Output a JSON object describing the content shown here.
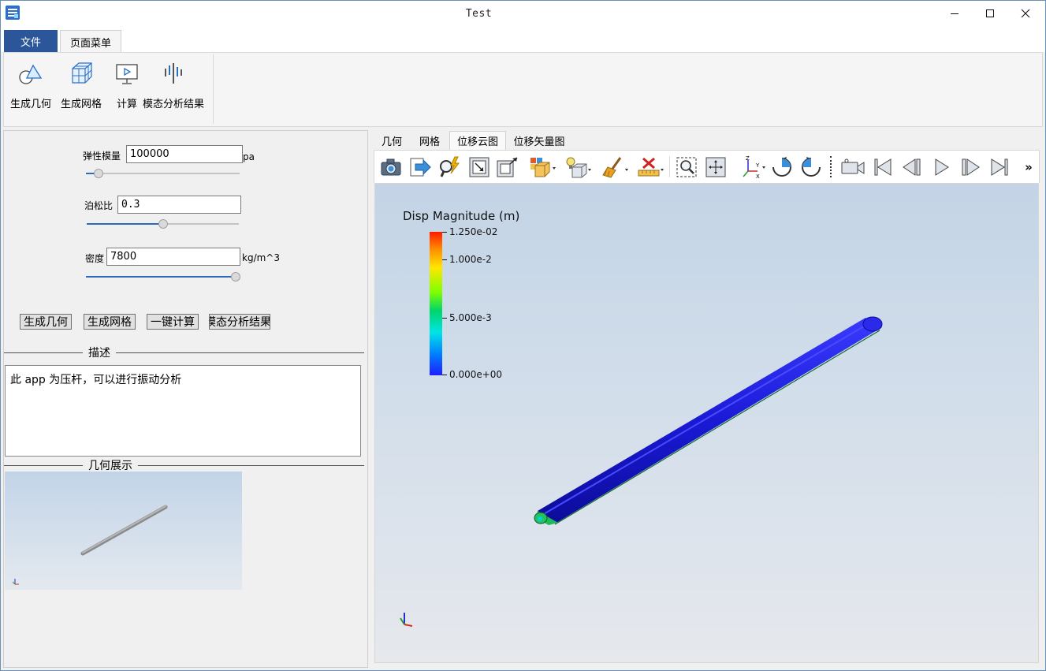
{
  "window": {
    "title": "Test",
    "icons": [
      "app-icon",
      "minimize-icon",
      "maximize-icon",
      "close-icon"
    ]
  },
  "ribbon": {
    "tabs": [
      {
        "label": "文件",
        "active": false
      },
      {
        "label": "页面菜单",
        "active": true
      }
    ],
    "buttons": [
      {
        "label": "生成几何",
        "icon": "geometry-icon"
      },
      {
        "label": "生成网格",
        "icon": "mesh-icon"
      },
      {
        "label": "计算",
        "icon": "compute-icon"
      },
      {
        "label": "模态分析结果",
        "icon": "modal-analysis-icon"
      }
    ]
  },
  "params": {
    "elastic_modulus": {
      "label": "弹性模量",
      "value": "100000",
      "unit": "pa",
      "slider_fraction": 0.08
    },
    "poisson_ratio": {
      "label": "泊松比",
      "value": "0.3",
      "unit": "",
      "slider_fraction": 0.5
    },
    "density": {
      "label": "密度",
      "value": "7800",
      "unit": "kg/m^3",
      "slider_fraction": 1.0
    }
  },
  "actions": [
    "生成几何",
    "生成网格",
    "一键计算",
    "模态分析结果"
  ],
  "description": {
    "title": "描述",
    "text": "此 app 为压杆，可以进行振动分析"
  },
  "geometry_preview": {
    "title": "几何展示"
  },
  "view_tabs": [
    {
      "label": "几何",
      "active": false
    },
    {
      "label": "网格",
      "active": false
    },
    {
      "label": "位移云图",
      "active": true
    },
    {
      "label": "位移矢量图",
      "active": false
    }
  ],
  "toolbar_icons": [
    "camera-icon",
    "export-icon",
    "probe-query-icon",
    "zoom-fit-icon",
    "zoom-box-icon",
    "color-cube-icon",
    "light-bulb-icon",
    "broom-icon",
    "delete-ruler-icon",
    "zoom-region-icon",
    "pan-icon",
    "axes-orient-icon",
    "rotate-cw-icon",
    "rotate-ccw-icon",
    "video-camera-icon",
    "first-frame-icon",
    "previous-frame-icon",
    "play-icon",
    "next-frame-icon",
    "last-frame-icon",
    "more-icon"
  ],
  "toolbar_more_label": "»",
  "colorbar": {
    "title": "Disp Magnitude (m)",
    "labels": [
      "1.250e-02",
      "1.000e-2",
      "5.000e-3",
      "0.000e+00"
    ],
    "values": [
      0.0125,
      0.01,
      0.005,
      0.0
    ],
    "colors": {
      "high": "#ff1a00",
      "low": "#1e1eff"
    }
  },
  "colors": {
    "ribbon_file_tab": "#2b579a",
    "rod_displacement": "#1a1ad6",
    "rod_geometry": "#9a9a9a"
  }
}
